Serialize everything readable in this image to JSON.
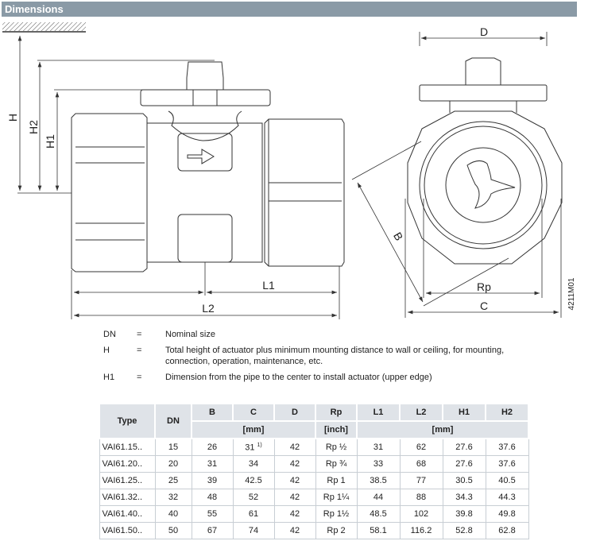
{
  "header": {
    "title": "Dimensions"
  },
  "drawing": {
    "labels": {
      "H": "H",
      "H2": "H2",
      "H1": "H1",
      "L1": "L1",
      "L2": "L2",
      "D": "D",
      "B": "B",
      "Rp": "Rp",
      "C": "C",
      "figure_id": "4211M01"
    }
  },
  "legend": [
    {
      "key": "DN",
      "eq": "=",
      "text": "Nominal size"
    },
    {
      "key": "H",
      "eq": "=",
      "text": "Total height of actuator plus minimum mounting distance to wall or ceiling, for mounting, connection, operation, maintenance, etc."
    },
    {
      "key": "H1",
      "eq": "=",
      "text": "Dimension from the pipe to the center to install actuator (upper edge)"
    }
  ],
  "table": {
    "headers": [
      "Type",
      "DN",
      "B",
      "C",
      "D",
      "Rp",
      "L1",
      "L2",
      "H1",
      "H2"
    ],
    "units": {
      "mm1": "[mm]",
      "inch": "[inch]",
      "mm2": "[mm]"
    },
    "footnote_mark": "1)",
    "rows": [
      [
        "VAI61.15..",
        "15",
        "26",
        "31",
        "42",
        "Rp ½",
        "31",
        "62",
        "27.6",
        "37.6"
      ],
      [
        "VAI61.20..",
        "20",
        "31",
        "34",
        "42",
        "Rp ¾",
        "33",
        "68",
        "27.6",
        "37.6"
      ],
      [
        "VAI61.25..",
        "25",
        "39",
        "42.5",
        "42",
        "Rp 1",
        "38.5",
        "77",
        "30.5",
        "40.5"
      ],
      [
        "VAI61.32..",
        "32",
        "48",
        "52",
        "42",
        "Rp 1¼",
        "44",
        "88",
        "34.3",
        "44.3"
      ],
      [
        "VAI61.40..",
        "40",
        "55",
        "61",
        "42",
        "Rp 1½",
        "48.5",
        "102",
        "39.8",
        "49.8"
      ],
      [
        "VAI61.50..",
        "50",
        "67",
        "74",
        "42",
        "Rp 2",
        "58.1",
        "116.2",
        "52.8",
        "62.8"
      ]
    ]
  }
}
